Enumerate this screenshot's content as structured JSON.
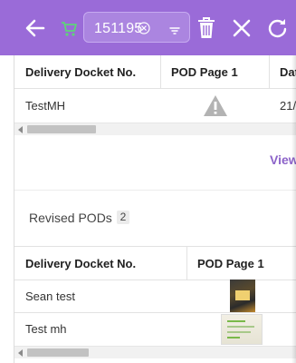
{
  "toolbar": {
    "background": "#9a6bd8",
    "docket_value": "151195",
    "icons": [
      "arrow-left-icon",
      "cart-icon",
      "clear-circle-icon",
      "filter-icon",
      "trash-icon",
      "close-icon",
      "refresh-icon"
    ]
  },
  "pod_grid": {
    "columns": [
      "Delivery Docket No.",
      "POD Page 1",
      "Dat"
    ],
    "rows": [
      {
        "docket": "TestMH",
        "pod_page_1": "warning-icon",
        "date": "21/"
      }
    ]
  },
  "view_link": "View",
  "revised": {
    "label": "Revised PODs",
    "count": "2",
    "columns": [
      "Delivery Docket No.",
      "POD Page 1"
    ],
    "rows": [
      {
        "docket": "Sean test",
        "pod_page_1": "photo-thumbnail"
      },
      {
        "docket": "Test mh",
        "pod_page_1": "document-thumbnail"
      }
    ]
  },
  "accent_color": "#8c63c9"
}
